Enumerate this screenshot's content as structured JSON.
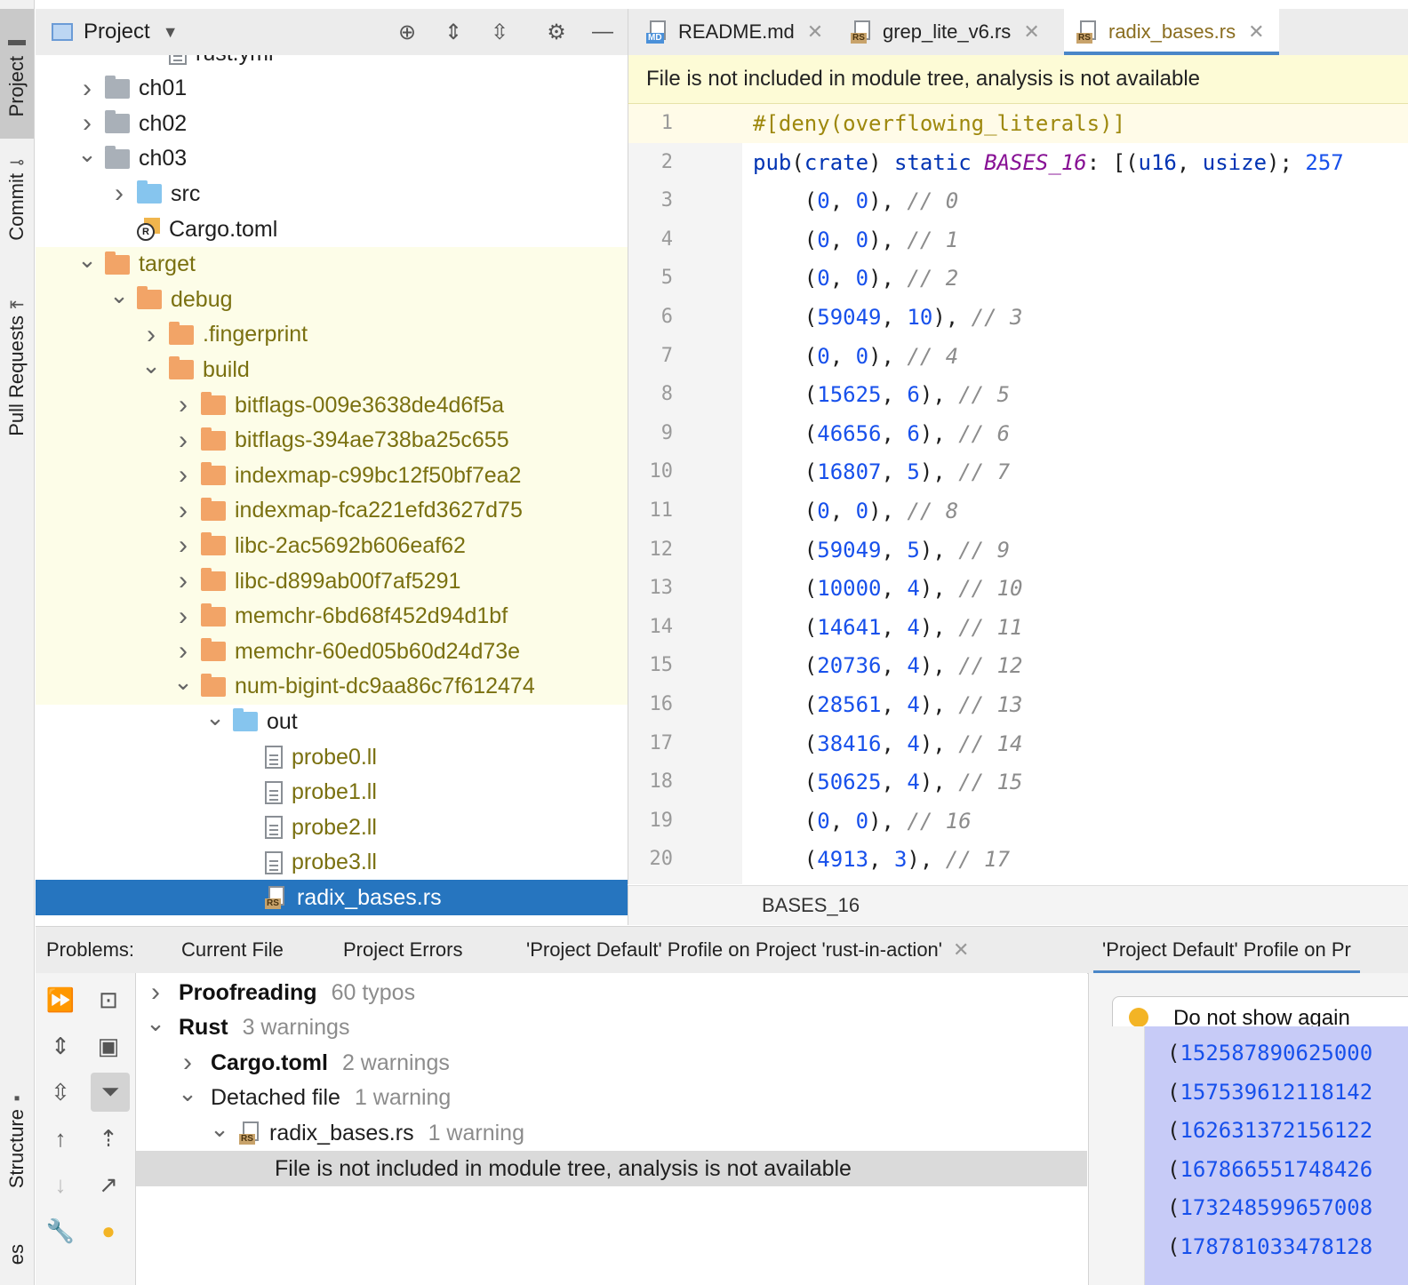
{
  "sidebar": {
    "project": "Project",
    "commit": "Commit",
    "pull_requests": "Pull Requests",
    "structure": "Structure",
    "es": "es"
  },
  "project_panel": {
    "title": "Project",
    "tree": [
      {
        "label": "rust.yml",
        "depth": 3,
        "icon": "yml",
        "arrow": "",
        "excluded": false
      },
      {
        "label": "ch01",
        "depth": 1,
        "icon": "folder-gray",
        "arrow": ">",
        "excluded": false
      },
      {
        "label": "ch02",
        "depth": 1,
        "icon": "folder-gray",
        "arrow": ">",
        "excluded": false
      },
      {
        "label": "ch03",
        "depth": 1,
        "icon": "folder-gray",
        "arrow": "v",
        "excluded": false
      },
      {
        "label": "src",
        "depth": 2,
        "icon": "folder-blue",
        "arrow": ">",
        "excluded": false
      },
      {
        "label": "Cargo.toml",
        "depth": 2,
        "icon": "cargo",
        "arrow": "",
        "excluded": false
      },
      {
        "label": "target",
        "depth": 1,
        "icon": "folder-orange",
        "arrow": "v",
        "excluded": true
      },
      {
        "label": "debug",
        "depth": 2,
        "icon": "folder-orange",
        "arrow": "v",
        "excluded": true
      },
      {
        "label": ".fingerprint",
        "depth": 3,
        "icon": "folder-orange",
        "arrow": ">",
        "excluded": true
      },
      {
        "label": "build",
        "depth": 3,
        "icon": "folder-orange",
        "arrow": "v",
        "excluded": true
      },
      {
        "label": "bitflags-009e3638de4d6f5a",
        "depth": 4,
        "icon": "folder-orange",
        "arrow": ">",
        "excluded": true
      },
      {
        "label": "bitflags-394ae738ba25c655",
        "depth": 4,
        "icon": "folder-orange",
        "arrow": ">",
        "excluded": true
      },
      {
        "label": "indexmap-c99bc12f50bf7ea2",
        "depth": 4,
        "icon": "folder-orange",
        "arrow": ">",
        "excluded": true
      },
      {
        "label": "indexmap-fca221efd3627d75",
        "depth": 4,
        "icon": "folder-orange",
        "arrow": ">",
        "excluded": true
      },
      {
        "label": "libc-2ac5692b606eaf62",
        "depth": 4,
        "icon": "folder-orange",
        "arrow": ">",
        "excluded": true
      },
      {
        "label": "libc-d899ab00f7af5291",
        "depth": 4,
        "icon": "folder-orange",
        "arrow": ">",
        "excluded": true
      },
      {
        "label": "memchr-6bd68f452d94d1bf",
        "depth": 4,
        "icon": "folder-orange",
        "arrow": ">",
        "excluded": true
      },
      {
        "label": "memchr-60ed05b60d24d73e",
        "depth": 4,
        "icon": "folder-orange",
        "arrow": ">",
        "excluded": true
      },
      {
        "label": "num-bigint-dc9aa86c7f612474",
        "depth": 4,
        "icon": "folder-orange",
        "arrow": "v",
        "excluded": true
      },
      {
        "label": "out",
        "depth": 5,
        "icon": "folder-blue",
        "arrow": "v",
        "excluded": false
      },
      {
        "label": "probe0.ll",
        "depth": 6,
        "icon": "file",
        "arrow": "",
        "excluded": false,
        "olive": true
      },
      {
        "label": "probe1.ll",
        "depth": 6,
        "icon": "file",
        "arrow": "",
        "excluded": false,
        "olive": true
      },
      {
        "label": "probe2.ll",
        "depth": 6,
        "icon": "file",
        "arrow": "",
        "excluded": false,
        "olive": true
      },
      {
        "label": "probe3.ll",
        "depth": 6,
        "icon": "file",
        "arrow": "",
        "excluded": false,
        "olive": true
      },
      {
        "label": "radix_bases.rs",
        "depth": 6,
        "icon": "rs",
        "arrow": "",
        "excluded": false,
        "selected": true
      }
    ]
  },
  "editor": {
    "tabs": [
      {
        "label": "README.md",
        "badge": "MD"
      },
      {
        "label": "grep_lite_v6.rs",
        "badge": "RS"
      },
      {
        "label": "radix_bases.rs",
        "badge": "RS",
        "active": true
      }
    ],
    "banner": "File is not included in module tree, analysis is not available",
    "line_numbers": [
      "1",
      "2",
      "3",
      "4",
      "5",
      "6",
      "7",
      "8",
      "9",
      "10",
      "11",
      "12",
      "13",
      "14",
      "15",
      "16",
      "17",
      "18",
      "19",
      "20"
    ],
    "attr_line": "#[deny(overflowing_literals)]",
    "decl": {
      "kw1": "pub",
      "p1": "(",
      "kw2": "crate",
      "p2": ") ",
      "kw3": "static",
      "sp": " ",
      "name": "BASES_16",
      "p3": ": [(",
      "t1": "u16",
      "p4": ", ",
      "t2": "usize",
      "p5": "); ",
      "n": "257"
    },
    "entries": [
      {
        "a": "0",
        "b": "0",
        "c": "// 0"
      },
      {
        "a": "0",
        "b": "0",
        "c": "// 1"
      },
      {
        "a": "0",
        "b": "0",
        "c": "// 2"
      },
      {
        "a": "59049",
        "b": "10",
        "c": "// 3"
      },
      {
        "a": "0",
        "b": "0",
        "c": "// 4"
      },
      {
        "a": "15625",
        "b": "6",
        "c": "// 5"
      },
      {
        "a": "46656",
        "b": "6",
        "c": "// 6"
      },
      {
        "a": "16807",
        "b": "5",
        "c": "// 7"
      },
      {
        "a": "0",
        "b": "0",
        "c": "// 8"
      },
      {
        "a": "59049",
        "b": "5",
        "c": "// 9"
      },
      {
        "a": "10000",
        "b": "4",
        "c": "// 10"
      },
      {
        "a": "14641",
        "b": "4",
        "c": "// 11"
      },
      {
        "a": "20736",
        "b": "4",
        "c": "// 12"
      },
      {
        "a": "28561",
        "b": "4",
        "c": "// 13"
      },
      {
        "a": "38416",
        "b": "4",
        "c": "// 14"
      },
      {
        "a": "50625",
        "b": "4",
        "c": "// 15"
      },
      {
        "a": "0",
        "b": "0",
        "c": "// 16"
      },
      {
        "a": "4913",
        "b": "3",
        "c": "// 17"
      }
    ],
    "breadcrumb": "BASES_16"
  },
  "problems": {
    "label": "Problems:",
    "tabs": [
      "Current File",
      "Project Errors",
      "'Project Default' Profile on Project 'rust-in-action'",
      "'Project Default' Profile on Pr"
    ],
    "tree": [
      {
        "label": "Proofreading",
        "count": "60 typos",
        "arrow": ">",
        "depth": 0,
        "bold": true
      },
      {
        "label": "Rust",
        "count": "3 warnings",
        "arrow": "v",
        "depth": 0,
        "bold": true
      },
      {
        "label": "Cargo.toml",
        "count": "2 warnings",
        "arrow": ">",
        "depth": 1,
        "bold": true
      },
      {
        "label": "Detached file",
        "count": "1 warning",
        "arrow": "v",
        "depth": 1,
        "bold": false
      },
      {
        "label": "radix_bases.rs",
        "count": "1 warning",
        "arrow": "v",
        "depth": 2,
        "bold": false,
        "rs": true
      },
      {
        "label": "File is not included in module tree, analysis is not available",
        "count": "",
        "arrow": "",
        "depth": 3,
        "bold": false,
        "selected": true
      }
    ],
    "preview": {
      "do_not_show": "Do not show again",
      "lines": [
        "152587890625000",
        "157539612118142",
        "162631372156122",
        "167866551748426",
        "173248599657008",
        "178781033478128"
      ]
    }
  },
  "colors": {
    "selection": "#2675bf",
    "excluded_bg": "#fdfde8",
    "banner_bg": "#fdfbd6",
    "number": "#1750eb",
    "keyword": "#0033b3",
    "attribute": "#9e880d"
  }
}
